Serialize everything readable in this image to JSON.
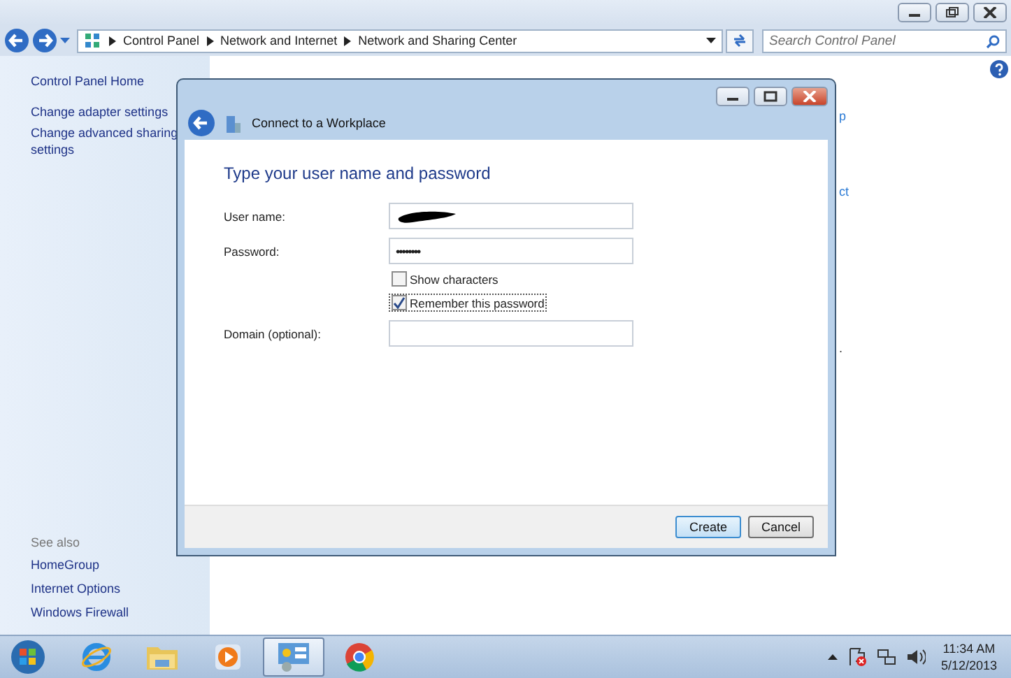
{
  "explorer": {
    "breadcrumbs": [
      "Control Panel",
      "Network and Internet",
      "Network and Sharing Center"
    ],
    "search": {
      "placeholder": "Search Control Panel"
    },
    "sidebar": {
      "home": "Control Panel Home",
      "tasks": [
        "Change adapter settings",
        "Change advanced sharing settings"
      ],
      "see_also_title": "See also",
      "see_also": [
        "HomeGroup",
        "Internet Options",
        "Windows Firewall"
      ]
    },
    "content_fragments": [
      "p",
      "ct",
      "."
    ]
  },
  "dialog": {
    "title": "Connect to a Workplace",
    "heading": "Type your user name and password",
    "fields": [
      {
        "kind": "text",
        "label": "User name:",
        "redacted": true
      },
      {
        "kind": "password",
        "label": "Password:",
        "value": "••••••••"
      },
      {
        "kind": "checkbox",
        "label": "Show characters",
        "checked": false,
        "focused": false
      },
      {
        "kind": "checkbox",
        "label": "Remember this password",
        "checked": true,
        "focused": true
      },
      {
        "kind": "text",
        "label": "Domain (optional):",
        "redacted": false
      }
    ],
    "buttons": [
      {
        "label": "Create",
        "default": true
      },
      {
        "label": "Cancel",
        "default": false
      }
    ]
  },
  "taskbar": {
    "apps": [
      {
        "kind": "ie",
        "active": false
      },
      {
        "kind": "folder",
        "active": false
      },
      {
        "kind": "media",
        "active": false
      },
      {
        "kind": "control",
        "active": true
      },
      {
        "kind": "chrome",
        "active": false
      }
    ],
    "time": "11:34 AM",
    "date": "5/12/2013"
  }
}
